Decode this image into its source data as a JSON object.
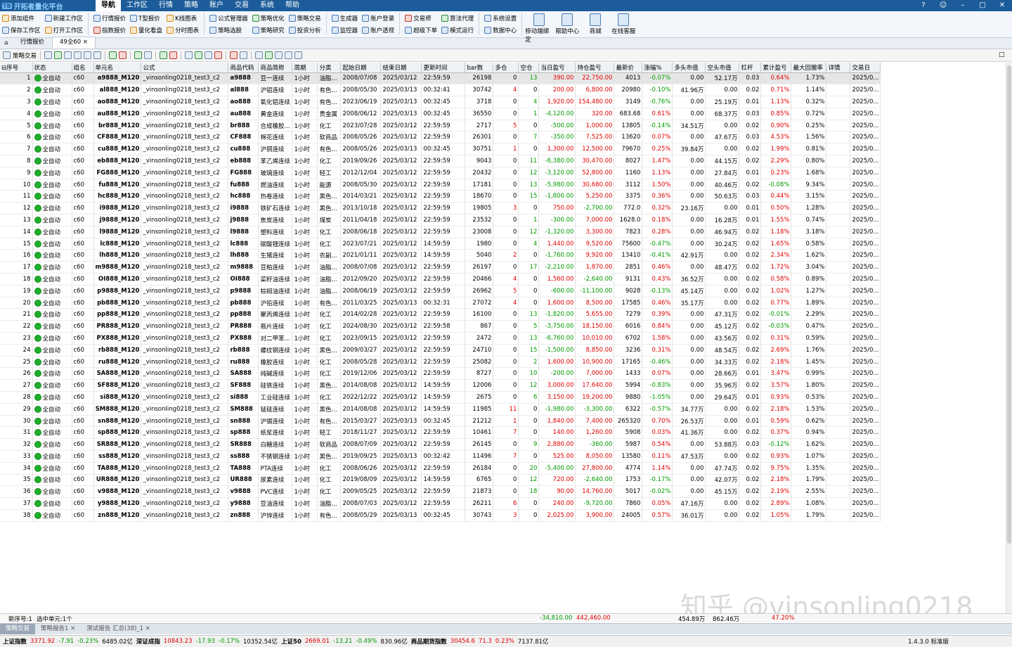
{
  "app": {
    "title": "开拓者量化平台",
    "version": "1.4.3.0 标准版"
  },
  "menu": [
    "导航",
    "工作区",
    "行情",
    "策略",
    "账户",
    "交易",
    "系统",
    "帮助"
  ],
  "ribbon": {
    "group1": [
      "添加组件",
      "保存工作区"
    ],
    "group2": [
      "新建工作区",
      "打开工作区"
    ],
    "group3": [
      "行情报价",
      "指数报价"
    ],
    "group4": [
      "T型报价",
      "量化看盘"
    ],
    "group5": [
      "K线图表",
      "分时图表"
    ],
    "group6": [
      "公式管理器",
      "策略选股"
    ],
    "group7": [
      "策略优化",
      "策略研究"
    ],
    "group8": [
      "策略交易",
      "投资分析"
    ],
    "group9": [
      "生成器",
      "监控器"
    ],
    "group10": [
      "账户登录",
      "账户透视"
    ],
    "group11": [
      "交易师",
      "超级下单"
    ],
    "group12": [
      "算法代理",
      "模式运行"
    ],
    "group13": [
      "系统设置",
      "数据中心"
    ],
    "big": [
      "移动端绑定",
      "帮助中心",
      "商城",
      "在线客服"
    ]
  },
  "tabs": [
    "行情报价",
    "49全60"
  ],
  "toolbar": {
    "strategy_trade": "策略交易"
  },
  "columns": [
    "序号",
    "状态",
    "组名",
    "单元名",
    "公式",
    "商品代码",
    "商品简称",
    "周期",
    "分类",
    "起始日期",
    "结束日期",
    "更新时间",
    "bar数",
    "多仓",
    "空仓",
    "当日盈亏",
    "持仓盈亏",
    "最新价",
    "涨幅%",
    "多头市值",
    "空头市值",
    "杠杆",
    "累计盈亏",
    "最大回撤率",
    "详情",
    "交易日"
  ],
  "rows": [
    [
      "1",
      "全自动",
      "c60",
      "a9888_M120",
      "_vinsonling0218_test3_c2",
      "a9888",
      "豆一连续",
      "1小时",
      "油脂...",
      "2008/07/08",
      "2025/03/12",
      "22:59:59",
      "26198",
      "0",
      "13",
      "390.00",
      "22,750.00",
      "4013",
      "-0.07%",
      "0.00",
      "52.17万",
      "0.03",
      "0.64%",
      "1.73%",
      "",
      "2025/0..."
    ],
    [
      "2",
      "全自动",
      "c60",
      "al888_M120",
      "_vinsonling0218_test3_c2",
      "al888",
      "沪铝连续",
      "1小时",
      "有色...",
      "2008/05/30",
      "2025/03/13",
      "00:32:41",
      "30742",
      "4",
      "0",
      "200.00",
      "6,800.00",
      "20980",
      "-0.10%",
      "41.96万",
      "0.00",
      "0.02",
      "0.71%",
      "1.14%",
      "",
      "2025/0..."
    ],
    [
      "3",
      "全自动",
      "c60",
      "ao888_M120",
      "_vinsonling0218_test3_c2",
      "ao888",
      "氧化铝连续",
      "1小时",
      "有色...",
      "2023/06/19",
      "2025/03/13",
      "00:32:45",
      "3718",
      "0",
      "4",
      "1,920.00",
      "154,480.00",
      "3149",
      "-0.76%",
      "0.00",
      "25.19万",
      "0.01",
      "1.13%",
      "0.32%",
      "",
      "2025/0..."
    ],
    [
      "4",
      "全自动",
      "c60",
      "au888_M120",
      "_vinsonling0218_test3_c2",
      "au888",
      "黄金连续",
      "1小时",
      "贵金属",
      "2008/06/12",
      "2025/03/13",
      "00:32:45",
      "36550",
      "0",
      "1",
      "-4,120.00",
      "320.00",
      "683.68",
      "0.61%",
      "0.00",
      "68.37万",
      "0.03",
      "0.85%",
      "0.72%",
      "",
      "2025/0..."
    ],
    [
      "5",
      "全自动",
      "c60",
      "br888_M120",
      "_vinsonling0218_test3_c2",
      "br888",
      "合成橡胶...",
      "1小时",
      "化工",
      "2023/07/28",
      "2025/03/12",
      "22:59:59",
      "2717",
      "5",
      "0",
      "-500.00",
      "1,000.00",
      "13805",
      "-0.14%",
      "34.51万",
      "0.00",
      "0.02",
      "0.90%",
      "0.25%",
      "",
      "2025/0..."
    ],
    [
      "6",
      "全自动",
      "c60",
      "CF888_M120",
      "_vinsonling0218_test3_c2",
      "CF888",
      "棉花连续",
      "1小时",
      "软商品",
      "2008/05/26",
      "2025/03/12",
      "22:59:59",
      "26301",
      "0",
      "7",
      "-350.00",
      "7,525.00",
      "13620",
      "0.07%",
      "0.00",
      "47.67万",
      "0.03",
      "4.53%",
      "1.56%",
      "",
      "2025/0..."
    ],
    [
      "7",
      "全自动",
      "c60",
      "cu888_M120",
      "_vinsonling0218_test3_c2",
      "cu888",
      "沪铜连续",
      "1小时",
      "有色...",
      "2008/05/26",
      "2025/03/13",
      "00:32:45",
      "30751",
      "1",
      "0",
      "1,300.00",
      "12,500.00",
      "79670",
      "0.25%",
      "39.84万",
      "0.00",
      "0.02",
      "1.99%",
      "0.81%",
      "",
      "2025/0..."
    ],
    [
      "8",
      "全自动",
      "c60",
      "eb888_M120",
      "_vinsonling0218_test3_c2",
      "eb888",
      "苯乙烯连续",
      "1小时",
      "化工",
      "2019/09/26",
      "2025/03/12",
      "22:59:59",
      "9043",
      "0",
      "11",
      "-6,380.00",
      "30,470.00",
      "8027",
      "1.47%",
      "0.00",
      "44.15万",
      "0.02",
      "2.29%",
      "0.80%",
      "",
      "2025/0..."
    ],
    [
      "9",
      "全自动",
      "c60",
      "FG888_M120",
      "_vinsonling0218_test3_c2",
      "FG888",
      "玻璃连续",
      "1小时",
      "轻工",
      "2012/12/04",
      "2025/03/12",
      "22:59:59",
      "20432",
      "0",
      "12",
      "-3,120.00",
      "52,800.00",
      "1160",
      "1.13%",
      "0.00",
      "27.84万",
      "0.01",
      "0.23%",
      "1.68%",
      "",
      "2025/0..."
    ],
    [
      "10",
      "全自动",
      "c60",
      "fu888_M120",
      "_vinsonling0218_test3_c2",
      "fu888",
      "燃油连续",
      "1小时",
      "能源",
      "2008/05/30",
      "2025/03/12",
      "22:59:59",
      "17181",
      "0",
      "13",
      "-5,980.00",
      "30,680.00",
      "3112",
      "1.50%",
      "0.00",
      "40.46万",
      "0.02",
      "-0.08%",
      "9.34%",
      "",
      "2025/0..."
    ],
    [
      "11",
      "全自动",
      "c60",
      "hc888_M120",
      "_vinsonling0218_test3_c2",
      "hc888",
      "热卷连续",
      "1小时",
      "黑色...",
      "2014/03/21",
      "2025/03/12",
      "22:59:59",
      "18670",
      "0",
      "15",
      "-1,800.00",
      "5,250.00",
      "3375",
      "0.36%",
      "0.00",
      "50.63万",
      "0.03",
      "0.44%",
      "3.15%",
      "",
      "2025/0..."
    ],
    [
      "12",
      "全自动",
      "c60",
      "i9888_M120",
      "_vinsonling0218_test3_c2",
      "i9888",
      "铁矿石连续",
      "1小时",
      "黑色...",
      "2013/10/18",
      "2025/03/12",
      "22:59:59",
      "19805",
      "3",
      "0",
      "750.00",
      "-2,700.00",
      "772.0",
      "0.32%",
      "23.16万",
      "0.00",
      "0.01",
      "0.50%",
      "1.28%",
      "",
      "2025/0..."
    ],
    [
      "13",
      "全自动",
      "c60",
      "j9888_M120",
      "_vinsonling0218_test3_c2",
      "j9888",
      "焦炭连续",
      "1小时",
      "煤炭",
      "2011/04/18",
      "2025/03/12",
      "22:59:59",
      "23532",
      "0",
      "1",
      "-300.00",
      "7,000.00",
      "1628.0",
      "0.18%",
      "0.00",
      "16.28万",
      "0.01",
      "1.55%",
      "0.74%",
      "",
      "2025/0..."
    ],
    [
      "14",
      "全自动",
      "c60",
      "l9888_M120",
      "_vinsonling0218_test3_c2",
      "l9888",
      "塑料连续",
      "1小时",
      "化工",
      "2008/06/18",
      "2025/03/12",
      "22:59:59",
      "23008",
      "0",
      "12",
      "-1,320.00",
      "3,300.00",
      "7823",
      "0.28%",
      "0.00",
      "46.94万",
      "0.02",
      "1.18%",
      "3.18%",
      "",
      "2025/0..."
    ],
    [
      "15",
      "全自动",
      "c60",
      "lc888_M120",
      "_vinsonling0218_test3_c2",
      "lc888",
      "碳酸锂连续",
      "1小时",
      "化工",
      "2023/07/21",
      "2025/03/12",
      "14:59:59",
      "1980",
      "0",
      "4",
      "1,440.00",
      "9,520.00",
      "75600",
      "-0.47%",
      "0.00",
      "30.24万",
      "0.02",
      "1.65%",
      "0.58%",
      "",
      "2025/0..."
    ],
    [
      "16",
      "全自动",
      "c60",
      "lh888_M120",
      "_vinsonling0218_test3_c2",
      "lh888",
      "生猪连续",
      "1小时",
      "农副...",
      "2021/01/11",
      "2025/03/12",
      "14:59:59",
      "5040",
      "2",
      "0",
      "-1,760.00",
      "9,920.00",
      "13410",
      "-0.41%",
      "42.91万",
      "0.00",
      "0.02",
      "2.34%",
      "1.62%",
      "",
      "2025/0..."
    ],
    [
      "17",
      "全自动",
      "c60",
      "m9888_M120",
      "_vinsonling0218_test3_c2",
      "m9888",
      "豆粕连续",
      "1小时",
      "油脂...",
      "2008/07/08",
      "2025/03/12",
      "22:59:59",
      "26197",
      "0",
      "17",
      "-2,210.00",
      "1,870.00",
      "2851",
      "0.46%",
      "0.00",
      "48.47万",
      "0.02",
      "1.72%",
      "3.04%",
      "",
      "2025/0..."
    ],
    [
      "18",
      "全自动",
      "c60",
      "OI888_M120",
      "_vinsonling0218_test3_c2",
      "OI888",
      "菜籽油连续",
      "1小时",
      "油脂...",
      "2012/09/20",
      "2025/03/12",
      "22:59:59",
      "20466",
      "4",
      "0",
      "1,560.00",
      "-2,640.00",
      "9131",
      "0.43%",
      "36.52万",
      "0.00",
      "0.02",
      "0.58%",
      "0.89%",
      "",
      "2025/0..."
    ],
    [
      "19",
      "全自动",
      "c60",
      "p9888_M120",
      "_vinsonling0218_test3_c2",
      "p9888",
      "棕榈油连续",
      "1小时",
      "油脂...",
      "2008/06/19",
      "2025/03/12",
      "22:59:59",
      "26962",
      "5",
      "0",
      "-600.00",
      "-11,100.00",
      "9028",
      "-0.13%",
      "45.14万",
      "0.00",
      "0.02",
      "1.02%",
      "1.27%",
      "",
      "2025/0..."
    ],
    [
      "20",
      "全自动",
      "c60",
      "pb888_M120",
      "_vinsonling0218_test3_c2",
      "pb888",
      "沪铅连续",
      "1小时",
      "有色...",
      "2011/03/25",
      "2025/03/13",
      "00:32:31",
      "27072",
      "4",
      "0",
      "1,600.00",
      "8,500.00",
      "17585",
      "0.46%",
      "35.17万",
      "0.00",
      "0.02",
      "0.77%",
      "1.89%",
      "",
      "2025/0..."
    ],
    [
      "21",
      "全自动",
      "c60",
      "pp888_M120",
      "_vinsonling0218_test3_c2",
      "pp888",
      "聚丙烯连续",
      "1小时",
      "化工",
      "2014/02/28",
      "2025/03/12",
      "22:59:59",
      "16100",
      "0",
      "13",
      "-1,820.00",
      "5,655.00",
      "7279",
      "0.39%",
      "0.00",
      "47.31万",
      "0.02",
      "-0.01%",
      "2.29%",
      "",
      "2025/0..."
    ],
    [
      "22",
      "全自动",
      "c60",
      "PR888_M120",
      "_vinsonling0218_test3_c2",
      "PR888",
      "瓶片连续",
      "1小时",
      "化工",
      "2024/08/30",
      "2025/03/12",
      "22:59:58",
      "867",
      "0",
      "5",
      "-3,750.00",
      "18,150.00",
      "6016",
      "0.84%",
      "0.00",
      "45.12万",
      "0.02",
      "-0.03%",
      "0.47%",
      "",
      "2025/0..."
    ],
    [
      "23",
      "全自动",
      "c60",
      "PX888_M120",
      "_vinsonling0218_test3_c2",
      "PX888",
      "对二甲苯...",
      "1小时",
      "化工",
      "2023/09/15",
      "2025/03/12",
      "22:59:59",
      "2472",
      "0",
      "13",
      "-6,760.00",
      "10,010.00",
      "6702",
      "1.58%",
      "0.00",
      "43.56万",
      "0.02",
      "0.31%",
      "0.59%",
      "",
      "2025/0..."
    ],
    [
      "24",
      "全自动",
      "c60",
      "rb888_M120",
      "_vinsonling0218_test3_c2",
      "rb888",
      "螺纹钢连续",
      "1小时",
      "黑色...",
      "2009/03/27",
      "2025/03/12",
      "22:59:59",
      "24710",
      "0",
      "15",
      "-1,500.00",
      "8,850.00",
      "3236",
      "0.31%",
      "0.00",
      "48.54万",
      "0.02",
      "2.69%",
      "1.76%",
      "",
      "2025/0..."
    ],
    [
      "25",
      "全自动",
      "c60",
      "ru888_M120",
      "_vinsonling0218_test3_c2",
      "ru888",
      "橡胶连续",
      "1小时",
      "化工",
      "2008/05/28",
      "2025/03/12",
      "22:59:59",
      "25082",
      "0",
      "2",
      "1,600.00",
      "10,900.00",
      "17165",
      "-0.46%",
      "0.00",
      "34.33万",
      "0.02",
      "2.18%",
      "1.45%",
      "",
      "2025/0..."
    ],
    [
      "26",
      "全自动",
      "c60",
      "SA888_M120",
      "_vinsonling0218_test3_c2",
      "SA888",
      "纯碱连续",
      "1小时",
      "化工",
      "2019/12/06",
      "2025/03/12",
      "22:59:59",
      "8727",
      "0",
      "10",
      "-200.00",
      "7,000.00",
      "1433",
      "0.07%",
      "0.00",
      "28.66万",
      "0.01",
      "3.47%",
      "0.99%",
      "",
      "2025/0..."
    ],
    [
      "27",
      "全自动",
      "c60",
      "SF888_M120",
      "_vinsonling0218_test3_c2",
      "SF888",
      "硅铁连续",
      "1小时",
      "黑色...",
      "2014/08/08",
      "2025/03/12",
      "14:59:59",
      "12006",
      "0",
      "12",
      "3,000.00",
      "17,640.00",
      "5994",
      "-0.83%",
      "0.00",
      "35.96万",
      "0.02",
      "3.57%",
      "1.80%",
      "",
      "2025/0..."
    ],
    [
      "28",
      "全自动",
      "c60",
      "si888_M120",
      "_vinsonling0218_test3_c2",
      "si888",
      "工业硅连续",
      "1小时",
      "化工",
      "2022/12/22",
      "2025/03/12",
      "14:59:59",
      "2675",
      "0",
      "6",
      "3,150.00",
      "19,200.00",
      "9880",
      "-1.05%",
      "0.00",
      "29.64万",
      "0.01",
      "0.93%",
      "0.53%",
      "",
      "2025/0..."
    ],
    [
      "29",
      "全自动",
      "c60",
      "SM888_M120",
      "_vinsonling0218_test3_c2",
      "SM888",
      "锰硅连续",
      "1小时",
      "黑色...",
      "2014/08/08",
      "2025/03/12",
      "14:59:59",
      "11985",
      "11",
      "0",
      "-1,980.00",
      "-3,300.00",
      "6322",
      "-0.57%",
      "34.77万",
      "0.00",
      "0.02",
      "2.18%",
      "1.53%",
      "",
      "2025/0..."
    ],
    [
      "30",
      "全自动",
      "c60",
      "sn888_M120",
      "_vinsonling0218_test3_c2",
      "sn888",
      "沪锡连续",
      "1小时",
      "有色...",
      "2015/03/27",
      "2025/03/13",
      "00:32:45",
      "21212",
      "1",
      "0",
      "1,840.00",
      "7,400.00",
      "265320",
      "0.70%",
      "26.53万",
      "0.00",
      "0.01",
      "0.59%",
      "0.62%",
      "",
      "2025/0..."
    ],
    [
      "31",
      "全自动",
      "c60",
      "sp888_M120",
      "_vinsonling0218_test3_c2",
      "sp888",
      "纸浆连续",
      "1小时",
      "轻工",
      "2018/11/27",
      "2025/03/12",
      "22:59:59",
      "10461",
      "7",
      "0",
      "140.00",
      "1,260.00",
      "5908",
      "0.03%",
      "41.36万",
      "0.00",
      "0.02",
      "0.37%",
      "0.94%",
      "",
      "2025/0..."
    ],
    [
      "32",
      "全自动",
      "c60",
      "SR888_M120",
      "_vinsonling0218_test3_c2",
      "SR888",
      "白糖连续",
      "1小时",
      "软商品",
      "2008/07/09",
      "2025/03/12",
      "22:59:59",
      "26145",
      "0",
      "9",
      "2,880.00",
      "-360.00",
      "5987",
      "0.54%",
      "0.00",
      "53.88万",
      "0.03",
      "-0.12%",
      "1.62%",
      "",
      "2025/0..."
    ],
    [
      "33",
      "全自动",
      "c60",
      "ss888_M120",
      "_vinsonling0218_test3_c2",
      "ss888",
      "不锈钢连续",
      "1小时",
      "黑色...",
      "2019/09/25",
      "2025/03/13",
      "00:32:42",
      "11496",
      "7",
      "0",
      "525.00",
      "8,050.00",
      "13580",
      "0.11%",
      "47.53万",
      "0.00",
      "0.02",
      "0.93%",
      "1.07%",
      "",
      "2025/0..."
    ],
    [
      "34",
      "全自动",
      "c60",
      "TA888_M120",
      "_vinsonling0218_test3_c2",
      "TA888",
      "PTA连续",
      "1小时",
      "化工",
      "2008/06/26",
      "2025/03/12",
      "22:59:59",
      "26184",
      "0",
      "20",
      "-5,400.00",
      "27,800.00",
      "4774",
      "1.14%",
      "0.00",
      "47.74万",
      "0.02",
      "9.75%",
      "1.35%",
      "",
      "2025/0..."
    ],
    [
      "35",
      "全自动",
      "c60",
      "UR888_M120",
      "_vinsonling0218_test3_c2",
      "UR888",
      "尿素连续",
      "1小时",
      "化工",
      "2019/08/09",
      "2025/03/12",
      "14:59:59",
      "6765",
      "0",
      "12",
      "720.00",
      "-2,640.00",
      "1753",
      "-0.17%",
      "0.00",
      "42.07万",
      "0.02",
      "2.18%",
      "1.79%",
      "",
      "2025/0..."
    ],
    [
      "36",
      "全自动",
      "c60",
      "v9888_M120",
      "_vinsonling0218_test3_c2",
      "v9888",
      "PVC连续",
      "1小时",
      "化工",
      "2009/05/25",
      "2025/03/12",
      "22:59:59",
      "21873",
      "0",
      "18",
      "90.00",
      "14,760.00",
      "5017",
      "-0.02%",
      "0.00",
      "45.15万",
      "0.02",
      "2.19%",
      "2.55%",
      "",
      "2025/0..."
    ],
    [
      "37",
      "全自动",
      "c60",
      "y9888_M120",
      "_vinsonling0218_test3_c2",
      "y9888",
      "豆油连续",
      "1小时",
      "油脂...",
      "2008/07/03",
      "2025/03/12",
      "22:59:59",
      "26211",
      "6",
      "0",
      "240.00",
      "-9,720.00",
      "7860",
      "0.05%",
      "47.16万",
      "0.00",
      "0.02",
      "2.89%",
      "1.08%",
      "",
      "2025/0..."
    ],
    [
      "38",
      "全自动",
      "c60",
      "zn888_M120",
      "_vinsonling0218_test3_c2",
      "zn888",
      "沪锌连续",
      "1小时",
      "有色...",
      "2008/05/29",
      "2025/03/13",
      "00:32:45",
      "30743",
      "3",
      "0",
      "2,025.00",
      "3,900.00",
      "24005",
      "0.57%",
      "36.01万",
      "0.00",
      "0.02",
      "1.05%",
      "1.79%",
      "",
      "2025/0..."
    ]
  ],
  "summary": {
    "new_seq": "新序号:1",
    "selected": "选中单元:1个",
    "day_pnl": "-34,810.00",
    "pos_pnl": "442,460.00",
    "long_val": "454.89万",
    "short_val": "862.46万",
    "cum": "47.20%"
  },
  "bottom_tabs": [
    "策略交易",
    "策略报告1",
    "测试报告 汇总(38)_1"
  ],
  "statusbar": [
    {
      "name": "上证指数",
      "vals": [
        "3371.92",
        "-7.91",
        "-0.23%",
        "6485.02亿"
      ]
    },
    {
      "name": "深证成指",
      "vals": [
        "10843.23",
        "-17.93",
        "-0.17%",
        "10352.54亿"
      ]
    },
    {
      "name": "上证50",
      "vals": [
        "2669.01",
        "-13.21",
        "-0.49%",
        "830.96亿"
      ]
    },
    {
      "name": "商品期货指数",
      "vals": [
        "30454.6",
        "71.3",
        "0.23%",
        "7137.81亿"
      ]
    }
  ],
  "watermark": "知乎 @vinsonling0218",
  "colors": {
    "titlebar": "#1d5c9a",
    "positive": "#e00000",
    "negative": "#009a00",
    "status_ok": "#1fae2a"
  }
}
